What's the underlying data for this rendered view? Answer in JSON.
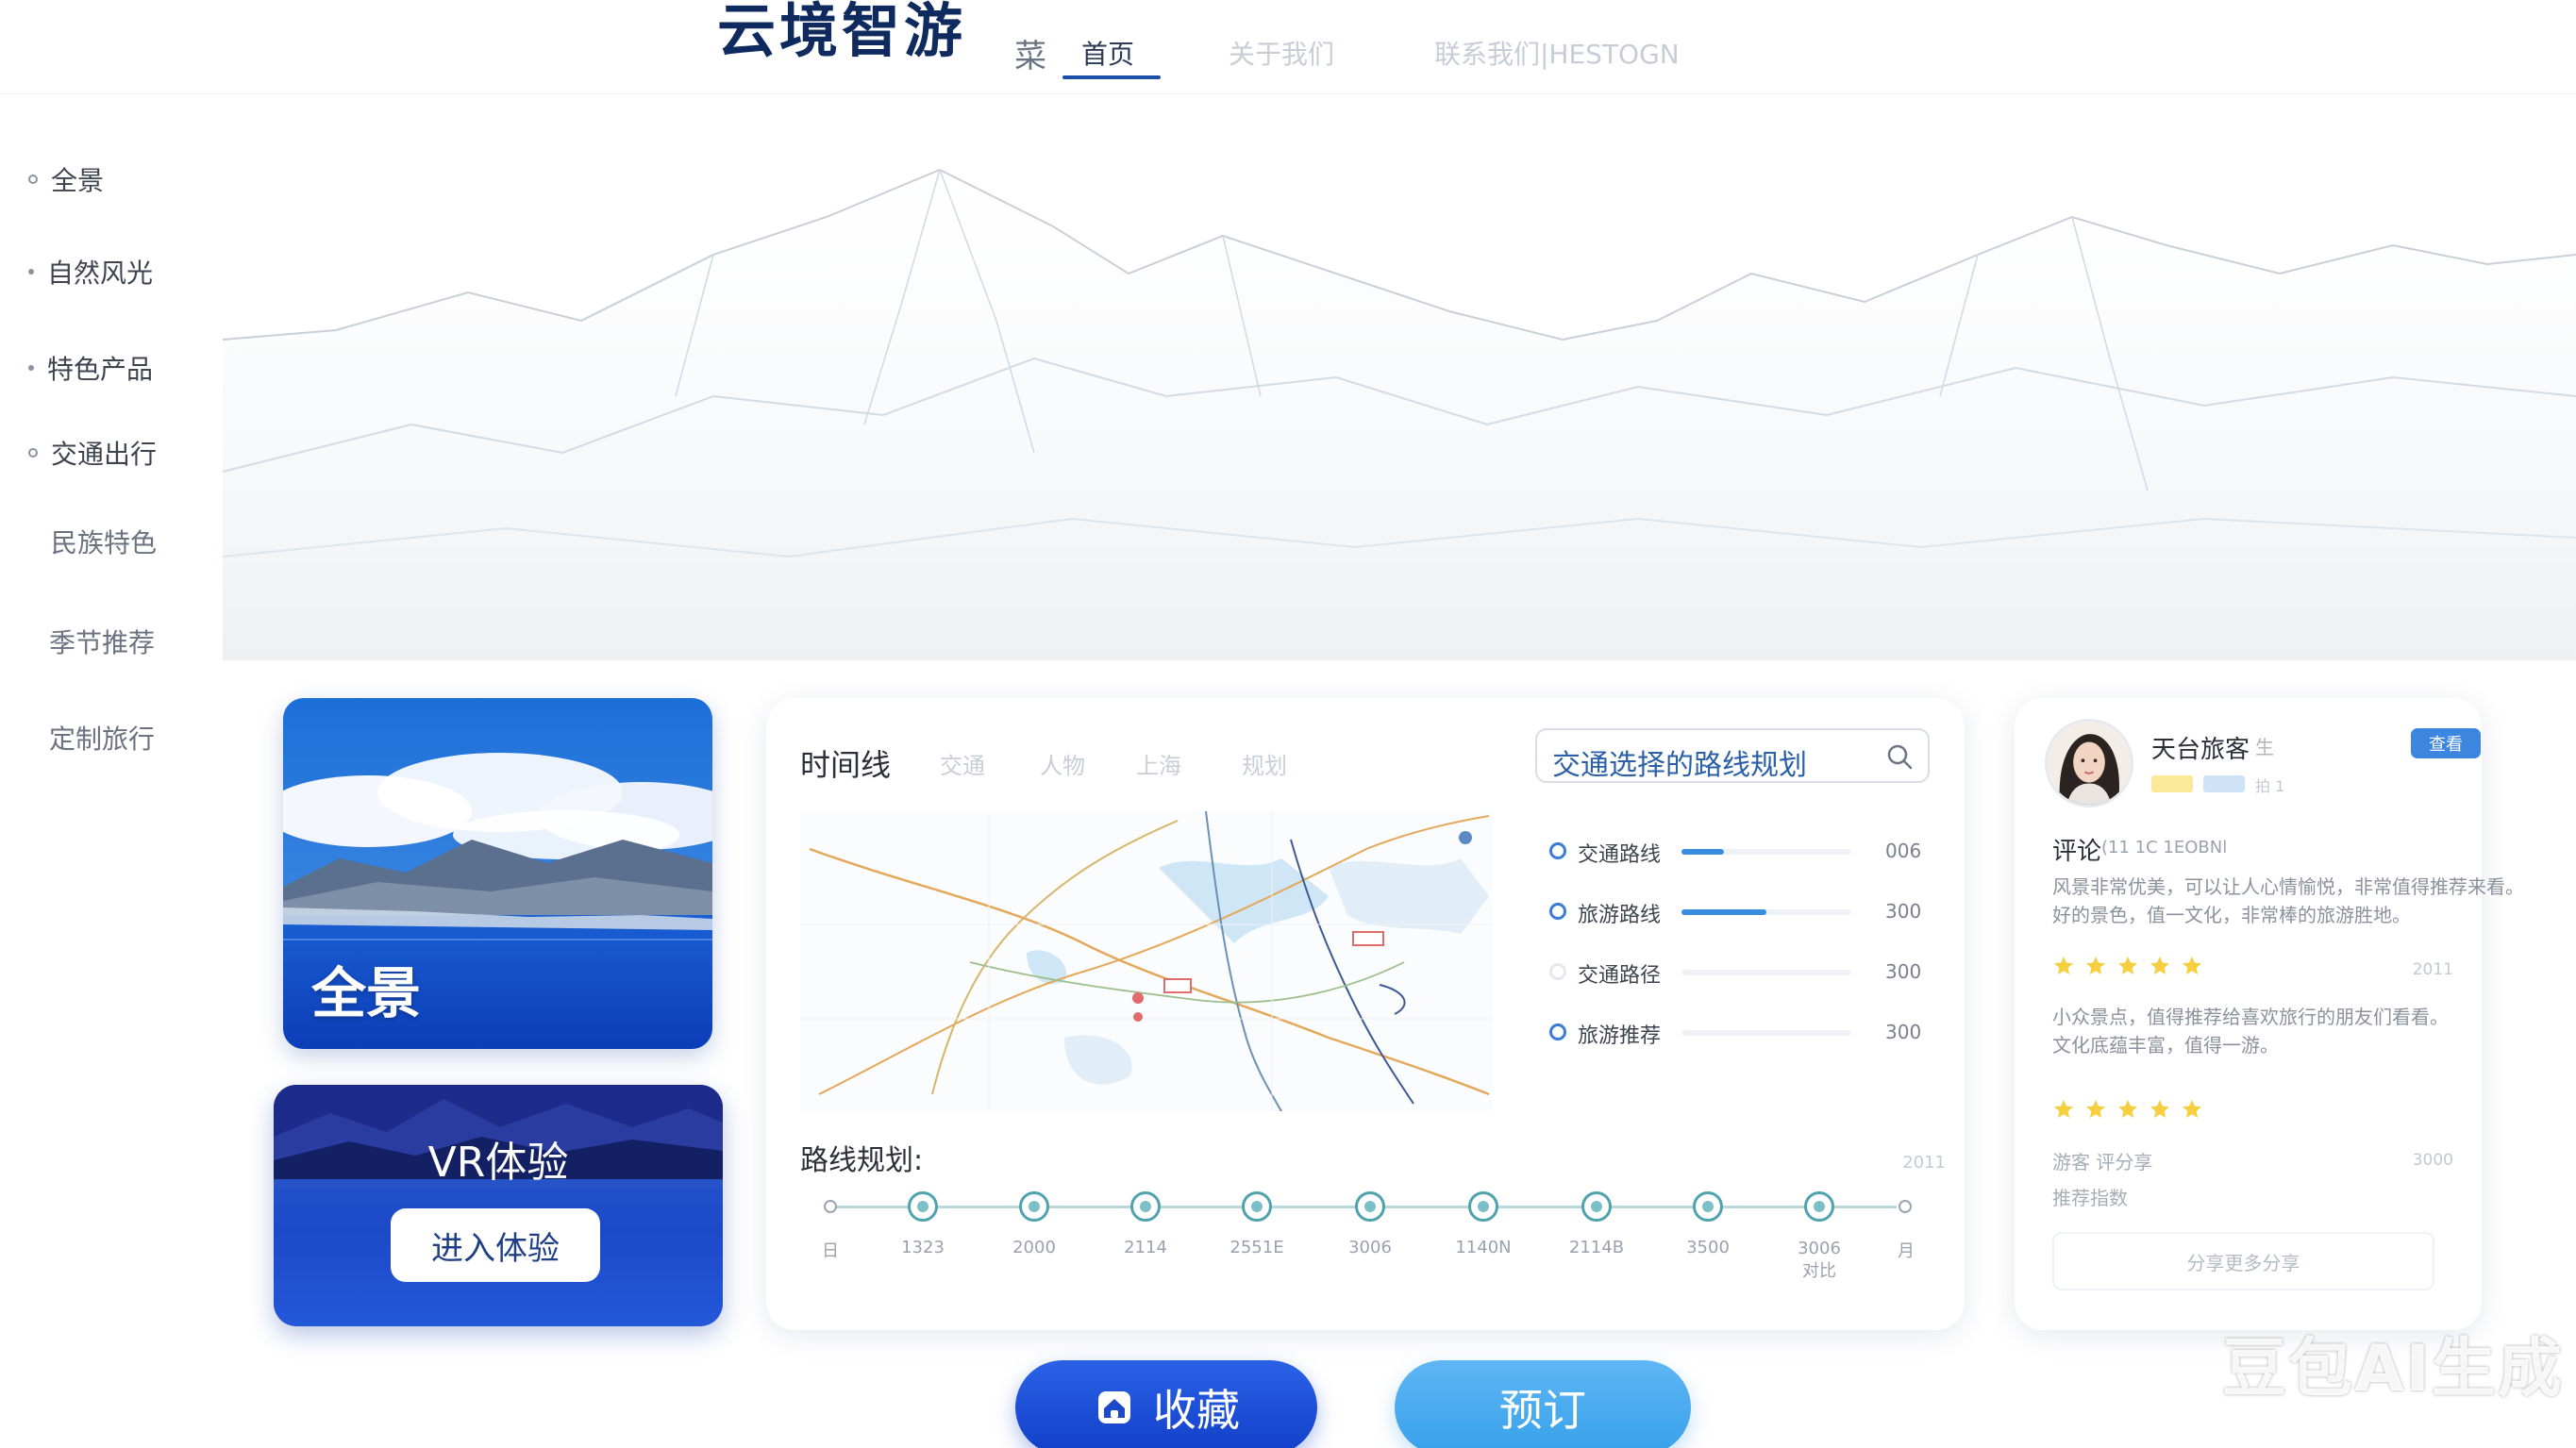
{
  "header": {
    "brand": "云境智游",
    "glyph": "菜",
    "tabs": [
      {
        "label": "首页",
        "active": true
      },
      {
        "label": "关于我们",
        "active": false
      },
      {
        "label": "联系我们|HESTOGN",
        "active": false
      }
    ]
  },
  "sidebar": {
    "items": [
      {
        "label": "全景"
      },
      {
        "label": "自然风光"
      },
      {
        "label": "特色产品"
      },
      {
        "label": "交通出行"
      },
      {
        "label": "民族特色"
      },
      {
        "label": "季节推荐"
      },
      {
        "label": "定制旅行"
      }
    ]
  },
  "panorama_card": {
    "title": "全景"
  },
  "vr_card": {
    "title": "VR体验",
    "button": "进入体验"
  },
  "timeline_panel": {
    "title": "时间线",
    "tabs": [
      "交通",
      "人物",
      "上海",
      "规划"
    ],
    "search": {
      "value": "交通选择的路线规划",
      "icon": "search-icon"
    },
    "stats": [
      {
        "label": "交通路线",
        "value": "006",
        "fill": 0.25
      },
      {
        "label": "旅游路线",
        "value": "300",
        "fill": 0.5
      },
      {
        "label": "交通路径",
        "value": "300",
        "fill": 0.0
      },
      {
        "label": "旅游推荐",
        "value": "300",
        "fill": 0.0
      }
    ],
    "route_title": "路线规划:",
    "route_corner": "2011",
    "route_labels": [
      "日",
      "1323",
      "2000",
      "2114",
      "2551E",
      "3006",
      "1140N",
      "2114B",
      "3500",
      "3006\n对比",
      "月"
    ]
  },
  "review_panel": {
    "name": "天台旅客",
    "name_tag": "生",
    "badge_text": "拍 1",
    "button": "查看",
    "comment_title": "评论",
    "comment_meta": "(11 1C 1EOBNl",
    "lines": [
      "风景非常优美，可以让人心情愉悦，非常值得推荐来看。",
      "好的景色，值一文化，非常棒的旅游胜地。"
    ],
    "stars_meta_1": "2011",
    "lines_2": [
      "小众景点，值得推荐给喜欢旅行的朋友们看看。",
      "文化底蕴丰富，值得一游。"
    ],
    "foot_1": "游客 评分享",
    "foot_1_meta": "3000",
    "foot_2": "推荐指数",
    "share": "分享更多分享"
  },
  "actions": {
    "favorite": "收藏",
    "book": "预订"
  },
  "watermark": "豆包AI生成",
  "colors": {
    "brand_navy": "#0f2a5e",
    "primary_blue": "#1d4fa8",
    "button_blue": "#123fc8",
    "light_blue": "#37a1ea",
    "teal_route": "#4fa3ad",
    "star_yellow": "#f5cf3d"
  }
}
